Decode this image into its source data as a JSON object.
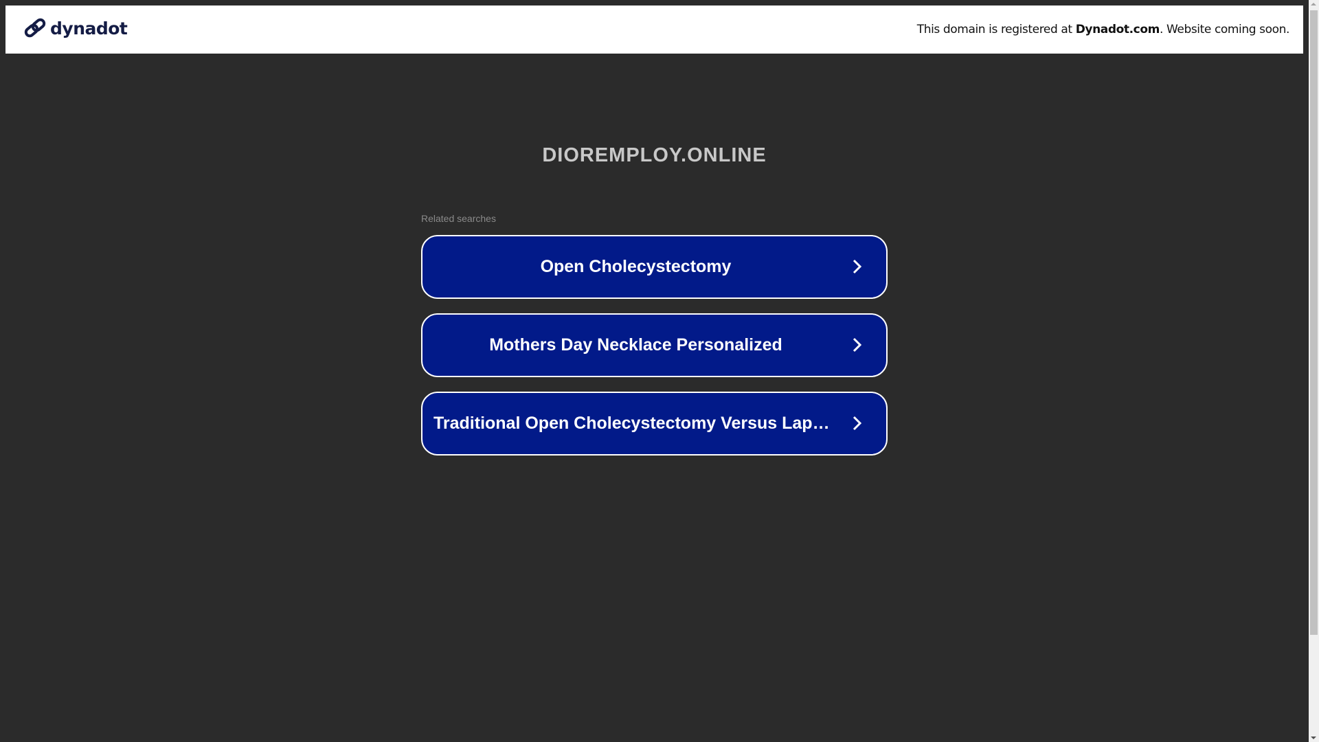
{
  "header": {
    "logo_text": "dynadot",
    "notice_prefix": "This domain is registered at ",
    "notice_brand": "Dynadot.com",
    "notice_suffix": ". Website coming soon."
  },
  "main": {
    "domain_title": "DIOREMPLOY.ONLINE",
    "related_label": "Related searches",
    "searches": [
      {
        "label": "Open Cholecystectomy"
      },
      {
        "label": "Mothers Day Necklace Personalized"
      },
      {
        "label": "Traditional Open Cholecystectomy Versus Laparoscopic Cholecystectomy"
      }
    ]
  },
  "colors": {
    "button_bg": "#021a89",
    "page_bg": "#2b2b2b",
    "logo": "#141c45"
  }
}
